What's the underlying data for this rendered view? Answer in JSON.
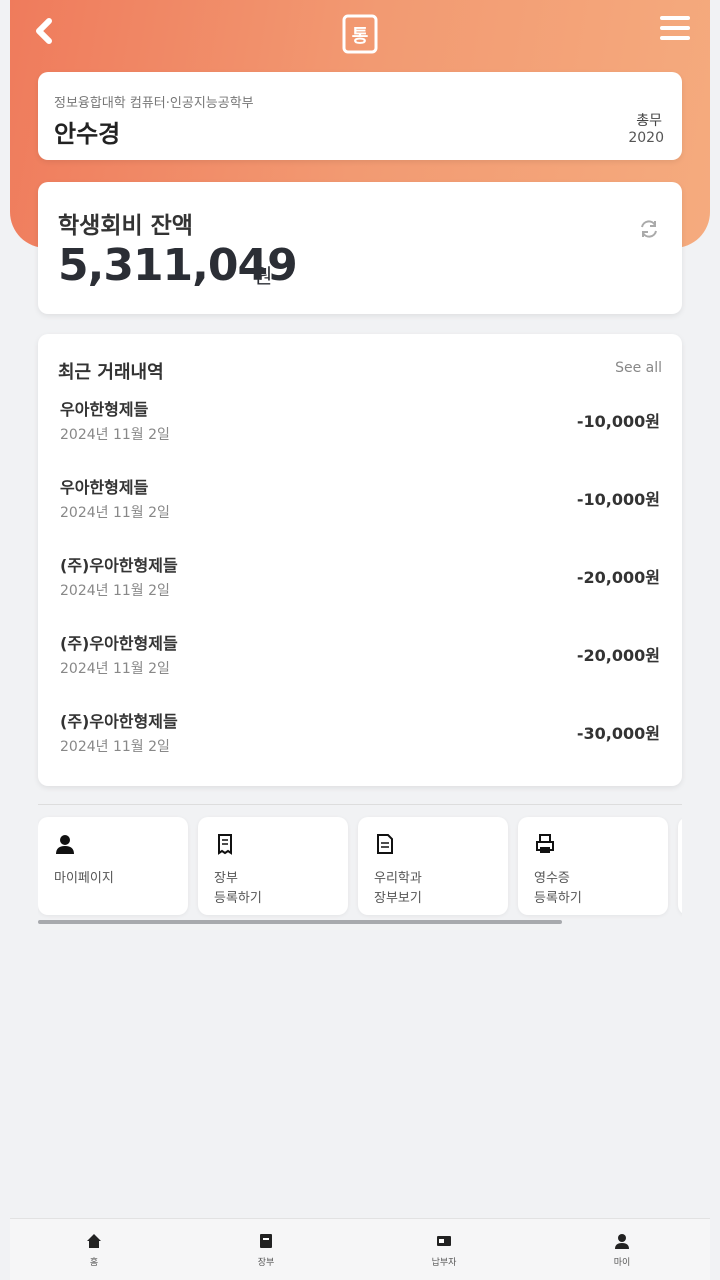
{
  "profile": {
    "department": "정보융합대학 컴퓨터·인공지능공학부",
    "name": "안수경",
    "role": "총무",
    "year": "2020"
  },
  "balance": {
    "label": "학생회비 잔액",
    "amount": "5,311,049",
    "unit": "원"
  },
  "transactions": {
    "title": "최근 거래내역",
    "see_all": "See all",
    "items": [
      {
        "merchant": "우아한형제들",
        "date": "2024년 11월 2일",
        "amount": "-10,000원"
      },
      {
        "merchant": "우아한형제들",
        "date": "2024년 11월 2일",
        "amount": "-10,000원"
      },
      {
        "merchant": "(주)우아한형제들",
        "date": "2024년 11월 2일",
        "amount": "-20,000원"
      },
      {
        "merchant": "(주)우아한형제들",
        "date": "2024년 11월 2일",
        "amount": "-20,000원"
      },
      {
        "merchant": "(주)우아한형제들",
        "date": "2024년 11월 2일",
        "amount": "-30,000원"
      }
    ]
  },
  "shortcuts": [
    {
      "icon": "person-icon",
      "line1": "마이페이지",
      "line2": ""
    },
    {
      "icon": "receipt-icon",
      "line1": "장부",
      "line2": "등록하기"
    },
    {
      "icon": "document-icon",
      "line1": "우리학과",
      "line2": "장부보기"
    },
    {
      "icon": "printer-icon",
      "line1": "영수증",
      "line2": "등록하기"
    }
  ],
  "bottom_nav": [
    {
      "icon": "home-icon",
      "label": "홈"
    },
    {
      "icon": "ledger-icon",
      "label": "장부"
    },
    {
      "icon": "payment-icon",
      "label": "납부자"
    },
    {
      "icon": "person-icon",
      "label": "마이"
    }
  ],
  "logo": {
    "glyph": "통"
  },
  "colors": {
    "accent_start": "#ef7b5c",
    "accent_end": "#f5ab7e",
    "background": "#f1f2f4"
  }
}
